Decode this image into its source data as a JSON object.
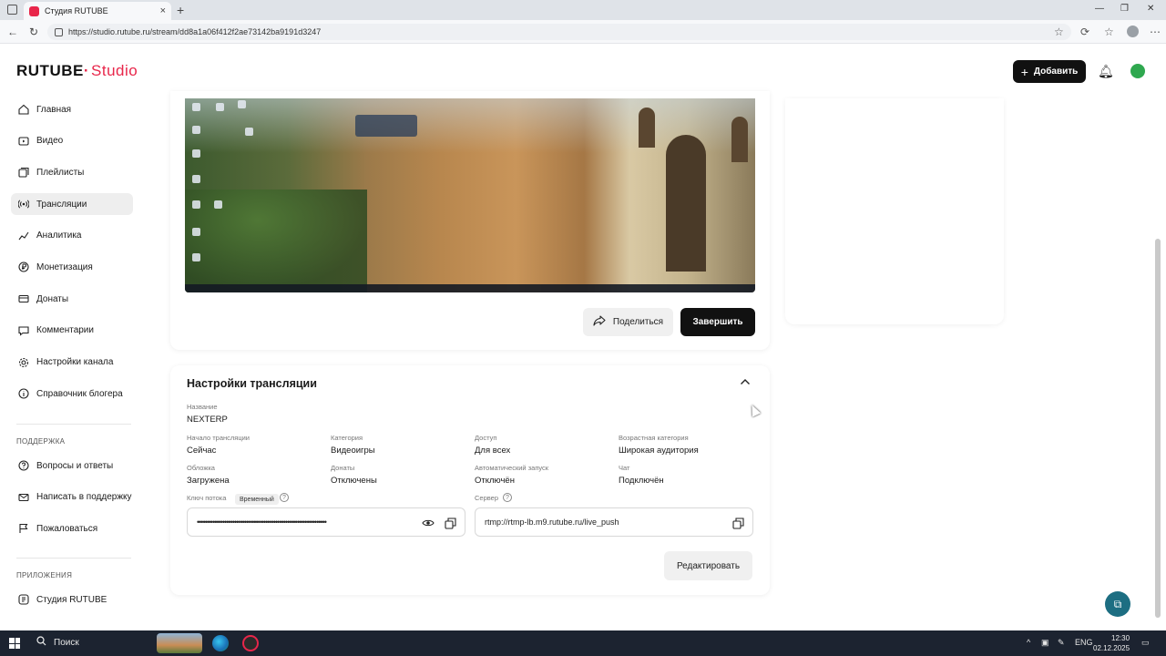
{
  "browser": {
    "tab_title": "Студия RUTUBE",
    "url": "https://studio.rutube.ru/stream/dd8a1a06f412f2ae73142ba9191d3247"
  },
  "header": {
    "logo_main": "RUTUBE",
    "logo_studio": "Studio",
    "add_label": "Добавить",
    "brand_color": "#e8264a"
  },
  "sidebar": {
    "items": [
      {
        "label": "Главная",
        "icon": "home-icon"
      },
      {
        "label": "Видео",
        "icon": "video-icon"
      },
      {
        "label": "Плейлисты",
        "icon": "playlist-icon"
      },
      {
        "label": "Трансляции",
        "icon": "broadcast-icon",
        "active": true
      },
      {
        "label": "Аналитика",
        "icon": "analytics-icon"
      },
      {
        "label": "Монетизация",
        "icon": "monetization-icon"
      },
      {
        "label": "Донаты",
        "icon": "donate-icon"
      },
      {
        "label": "Комментарии",
        "icon": "comments-icon"
      },
      {
        "label": "Настройки канала",
        "icon": "gear-icon"
      },
      {
        "label": "Справочник блогера",
        "icon": "info-icon"
      }
    ],
    "support_title": "ПОДДЕРЖКА",
    "support_items": [
      {
        "label": "Вопросы и ответы",
        "icon": "question-icon"
      },
      {
        "label": "Написать в поддержку",
        "icon": "mail-icon"
      },
      {
        "label": "Пожаловаться",
        "icon": "flag-icon"
      }
    ],
    "apps_title": "ПРИЛОЖЕНИЯ",
    "apps_items": [
      {
        "label": "Студия RUTUBE",
        "icon": "studio-icon"
      }
    ]
  },
  "player": {
    "share_label": "Поделиться",
    "end_label": "Завершить"
  },
  "settings": {
    "title": "Настройки трансляции",
    "name_label": "Название",
    "name_value": "NEXTERP",
    "fields": [
      {
        "label": "Начало трансляции",
        "value": "Сейчас"
      },
      {
        "label": "Категория",
        "value": "Видеоигры"
      },
      {
        "label": "Доступ",
        "value": "Для всех"
      },
      {
        "label": "Возрастная категория",
        "value": "Широкая аудитория"
      },
      {
        "label": "Обложка",
        "value": "Загружена"
      },
      {
        "label": "Донаты",
        "value": "Отключены"
      },
      {
        "label": "Автоматический запуск",
        "value": "Отключён"
      },
      {
        "label": "Чат",
        "value": "Подключён"
      }
    ],
    "key_label": "Ключ потока",
    "key_badge": "Временный",
    "key_value": "••••••••••••••••••••••••••••••••••••••••••••••••••••••••••••••••••",
    "server_label": "Сервер",
    "server_value": "rtmp://rtmp-lb.m9.rutube.ru/live_push",
    "edit_label": "Редактировать"
  },
  "taskbar": {
    "search_label": "Поиск",
    "lang": "ENG",
    "time": "12:30",
    "date": "02.12.2025"
  }
}
